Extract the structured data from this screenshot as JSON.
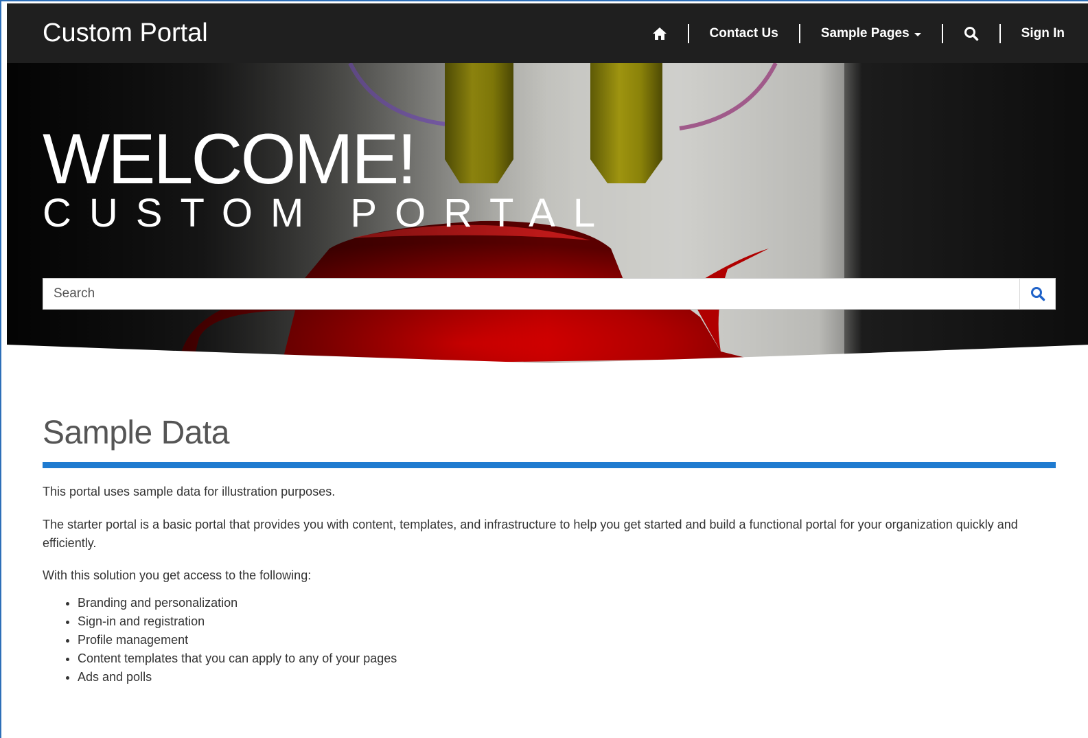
{
  "nav": {
    "brand": "Custom Portal",
    "home_icon": "home-icon",
    "contact_label": "Contact Us",
    "sample_pages_label": "Sample Pages",
    "search_icon": "search-icon",
    "sign_in_label": "Sign In"
  },
  "hero": {
    "title": "WELCOME!",
    "subtitle": "CUSTOM PORTAL",
    "search_placeholder": "Search",
    "search_icon": "search-icon"
  },
  "content": {
    "title": "Sample Data",
    "accent_color": "#1f7bd0",
    "paragraph_1": "This portal uses sample data for illustration purposes.",
    "paragraph_2": "The starter portal is a basic portal that provides you with content, templates, and infrastructure to help you get started and build a functional portal for your organization quickly and efficiently.",
    "paragraph_3": "With this solution you get access to the following:",
    "features": [
      "Branding and personalization",
      "Sign-in and registration",
      "Profile management",
      "Content templates that you can apply to any of your pages",
      "Ads and polls"
    ]
  },
  "colors": {
    "navbar_bg": "#1f1f1f",
    "link_accent": "#1f62c8"
  }
}
